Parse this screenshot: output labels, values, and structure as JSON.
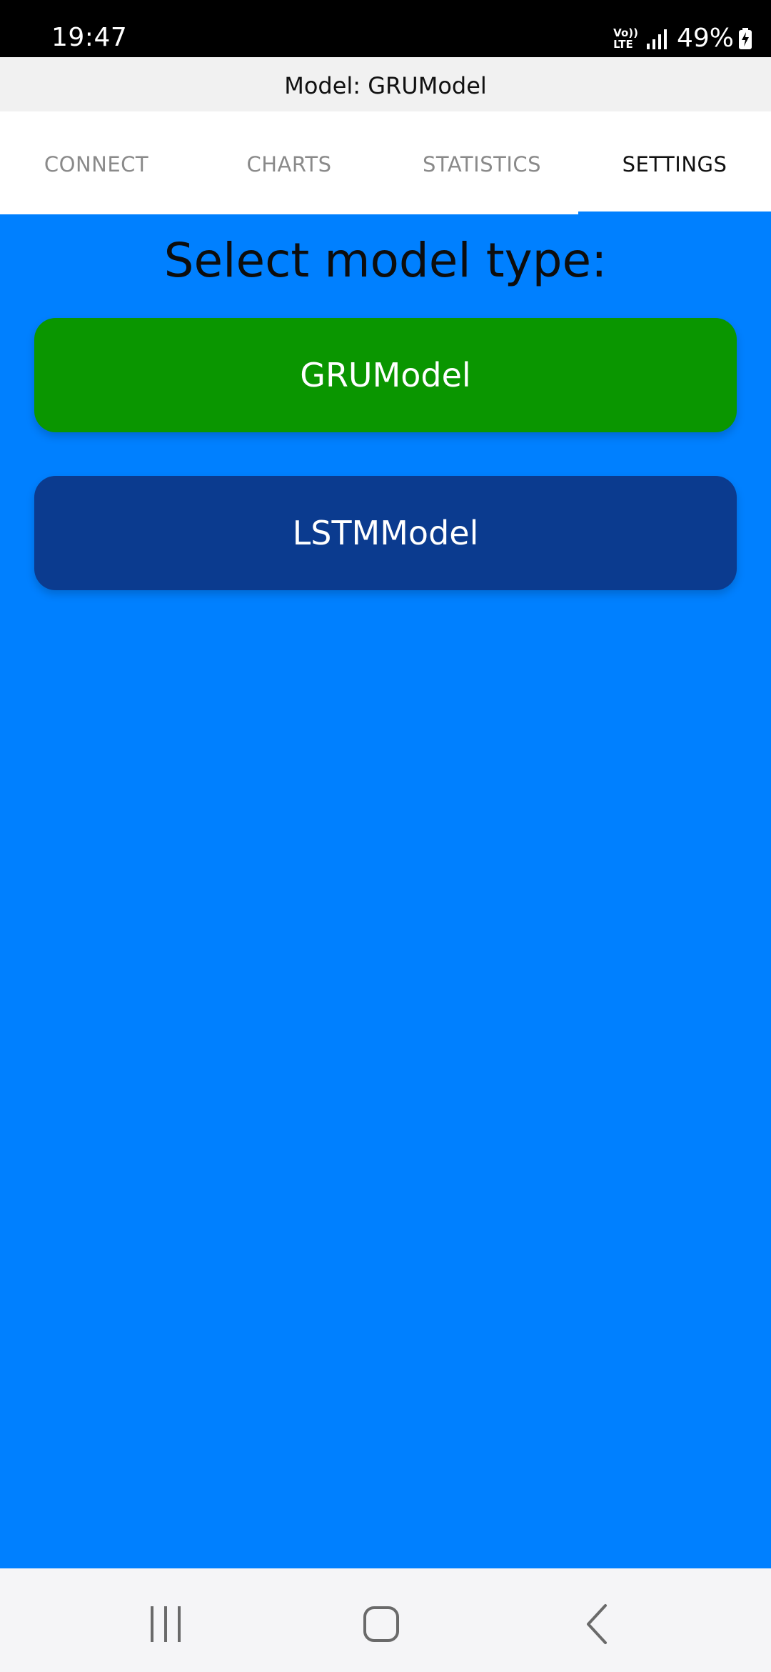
{
  "status_bar": {
    "time": "19:47",
    "volte_top": "Vo))",
    "volte_bottom": "LTE",
    "battery": "49%",
    "icons": [
      "signal-icon",
      "battery-charging-icon"
    ]
  },
  "app": {
    "title": "Model: GRUModel"
  },
  "tabs": [
    {
      "label": "CONNECT",
      "active": false
    },
    {
      "label": "CHARTS",
      "active": false
    },
    {
      "label": "STATISTICS",
      "active": false
    },
    {
      "label": "SETTINGS",
      "active": true
    }
  ],
  "settings": {
    "heading": "Select model type:",
    "options": [
      {
        "label": "GRUModel",
        "selected": true
      },
      {
        "label": "LSTMModel",
        "selected": false
      }
    ]
  },
  "nav": {
    "icons": [
      "recent-apps-icon",
      "home-icon",
      "back-icon"
    ]
  },
  "colors": {
    "content_bg": "#0080ff",
    "selected_option": "#0a9600",
    "unselected_option": "#0b3b8f",
    "tab_indicator": "#0080ff"
  }
}
